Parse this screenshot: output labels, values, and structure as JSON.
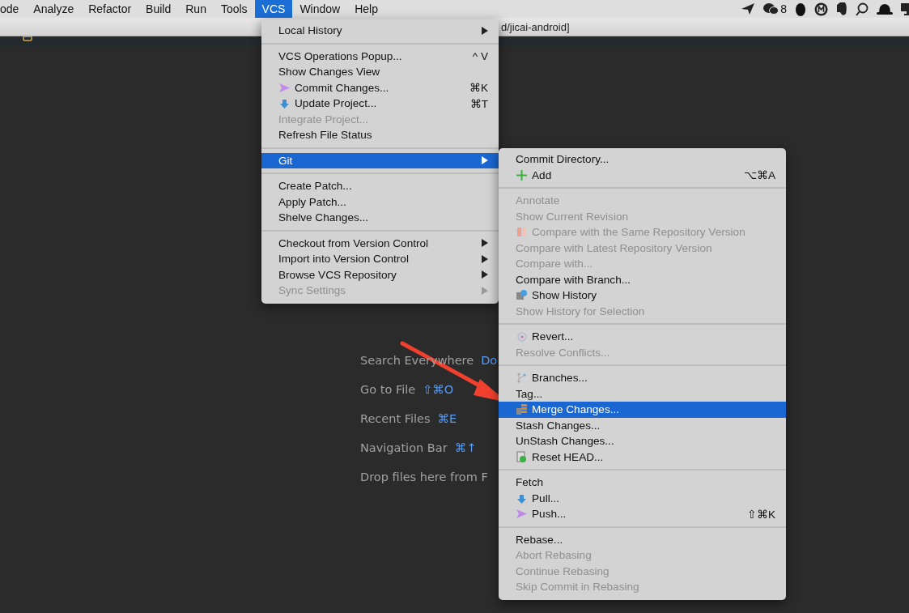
{
  "menubar": {
    "items": [
      {
        "label": "ode",
        "selected": false
      },
      {
        "label": "Analyze",
        "selected": false
      },
      {
        "label": "Refactor",
        "selected": false
      },
      {
        "label": "Build",
        "selected": false
      },
      {
        "label": "Run",
        "selected": false
      },
      {
        "label": "Tools",
        "selected": false
      },
      {
        "label": "VCS",
        "selected": true
      },
      {
        "label": "Window",
        "selected": false
      },
      {
        "label": "Help",
        "selected": false
      }
    ],
    "status_count": "8"
  },
  "title_bar": {
    "text": "d/jicai-android]"
  },
  "hints": [
    {
      "label": "Search Everywhere",
      "shortcut": "Do"
    },
    {
      "label": "Go to File",
      "shortcut": "⇧⌘O"
    },
    {
      "label": "Recent Files",
      "shortcut": "⌘E"
    },
    {
      "label": "Navigation Bar",
      "shortcut": "⌘↑"
    },
    {
      "label": "Drop files here from F"
    }
  ],
  "vcs_menu": {
    "sections": [
      [
        {
          "label": "Local History",
          "disabled": false,
          "selected": false,
          "submenu": true
        }
      ],
      [
        {
          "label": "VCS Operations Popup...",
          "shortcut": "^ V",
          "disabled": false,
          "selected": false,
          "submenu": false
        },
        {
          "label": "Show Changes View",
          "disabled": false,
          "selected": false,
          "submenu": false
        },
        {
          "label": "Commit Changes...",
          "shortcut": "⌘K",
          "disabled": false,
          "selected": false,
          "submenu": false
        },
        {
          "label": "Update Project...",
          "shortcut": "⌘T",
          "disabled": false,
          "selected": false,
          "submenu": false
        },
        {
          "label": "Integrate Project...",
          "disabled": true,
          "selected": false,
          "submenu": false
        },
        {
          "label": "Refresh File Status",
          "disabled": false,
          "selected": false,
          "submenu": false
        }
      ],
      [
        {
          "label": "Git",
          "disabled": false,
          "selected": true,
          "submenu": true
        }
      ],
      [
        {
          "label": "Create Patch...",
          "disabled": false,
          "selected": false,
          "submenu": false
        },
        {
          "label": "Apply Patch...",
          "disabled": false,
          "selected": false,
          "submenu": false
        },
        {
          "label": "Shelve Changes...",
          "disabled": false,
          "selected": false,
          "submenu": false
        }
      ],
      [
        {
          "label": "Checkout from Version Control",
          "disabled": false,
          "selected": false,
          "submenu": true
        },
        {
          "label": "Import into Version Control",
          "disabled": false,
          "selected": false,
          "submenu": true
        },
        {
          "label": "Browse VCS Repository",
          "disabled": false,
          "selected": false,
          "submenu": true
        },
        {
          "label": "Sync Settings",
          "disabled": true,
          "selected": false,
          "submenu": true
        }
      ]
    ]
  },
  "git_menu": {
    "sections": [
      [
        {
          "label": "Commit Directory...",
          "disabled": false,
          "selected": false
        },
        {
          "label": "Add",
          "shortcut": "⌥⌘A",
          "disabled": false,
          "selected": false
        }
      ],
      [
        {
          "label": "Annotate",
          "disabled": true,
          "selected": false
        },
        {
          "label": "Show Current Revision",
          "disabled": true,
          "selected": false
        },
        {
          "label": "Compare with the Same Repository Version",
          "disabled": true,
          "selected": false
        },
        {
          "label": "Compare with Latest Repository Version",
          "disabled": true,
          "selected": false
        },
        {
          "label": "Compare with...",
          "disabled": true,
          "selected": false
        },
        {
          "label": "Compare with Branch...",
          "disabled": false,
          "selected": false
        },
        {
          "label": "Show History",
          "disabled": false,
          "selected": false
        },
        {
          "label": "Show History for Selection",
          "disabled": true,
          "selected": false
        }
      ],
      [
        {
          "label": "Revert...",
          "disabled": false,
          "selected": false
        },
        {
          "label": "Resolve Conflicts...",
          "disabled": true,
          "selected": false
        }
      ],
      [
        {
          "label": "Branches...",
          "disabled": false,
          "selected": false
        },
        {
          "label": "Tag...",
          "disabled": false,
          "selected": false
        },
        {
          "label": "Merge Changes...",
          "disabled": false,
          "selected": true
        },
        {
          "label": "Stash Changes...",
          "disabled": false,
          "selected": false
        },
        {
          "label": "UnStash Changes...",
          "disabled": false,
          "selected": false
        },
        {
          "label": "Reset HEAD...",
          "disabled": false,
          "selected": false
        }
      ],
      [
        {
          "label": "Fetch",
          "disabled": false,
          "selected": false
        },
        {
          "label": "Pull...",
          "disabled": false,
          "selected": false
        },
        {
          "label": "Push...",
          "shortcut": "⇧⌘K",
          "disabled": false,
          "selected": false
        }
      ],
      [
        {
          "label": "Rebase...",
          "disabled": false,
          "selected": false
        },
        {
          "label": "Abort Rebasing",
          "disabled": true,
          "selected": false
        },
        {
          "label": "Continue Rebasing",
          "disabled": true,
          "selected": false
        },
        {
          "label": "Skip Commit in Rebasing",
          "disabled": true,
          "selected": false
        }
      ]
    ]
  }
}
